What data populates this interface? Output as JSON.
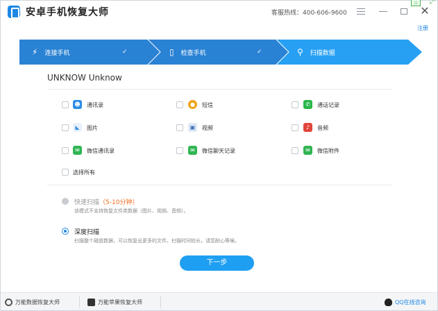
{
  "window": {
    "title": "安卓手机恢复大师",
    "hotline": "客服热线：400-606-9600",
    "register_link": "注册"
  },
  "steps": [
    {
      "label": "连接手机",
      "icon": "plug-icon",
      "done": true
    },
    {
      "label": "检查手机",
      "icon": "phone-icon",
      "done": true
    },
    {
      "label": "扫描数据",
      "icon": "search-icon",
      "done": false
    }
  ],
  "colors": {
    "step_done": "#2a82d4",
    "step_active": "#27a0f3",
    "accent": "#1e88e5",
    "highlight": "#f26b1d"
  },
  "device": {
    "name": "UNKNOW Unknow"
  },
  "categories": [
    {
      "label": "通讯录",
      "icon": "contacts-icon",
      "color": "#2d8ee8",
      "checked": false
    },
    {
      "label": "短信",
      "icon": "sms-icon",
      "color": "#f0a419",
      "checked": false
    },
    {
      "label": "通话记录",
      "icon": "call-log-icon",
      "color": "#28b84a",
      "checked": false
    },
    {
      "label": "图片",
      "icon": "picture-icon",
      "color": "#3a8de0",
      "checked": false
    },
    {
      "label": "视频",
      "icon": "video-icon",
      "color": "#3b6fb6",
      "checked": false
    },
    {
      "label": "音频",
      "icon": "audio-icon",
      "color": "#e2453c",
      "checked": false
    },
    {
      "label": "微信通讯录",
      "icon": "wechat-icon",
      "color": "#2fb551",
      "checked": false
    },
    {
      "label": "微信聊天记录",
      "icon": "wechat-icon",
      "color": "#2fb551",
      "checked": false
    },
    {
      "label": "微信附件",
      "icon": "wechat-icon",
      "color": "#2fb551",
      "checked": false
    }
  ],
  "select_all": {
    "label": "选择所有",
    "checked": false
  },
  "scan_modes": {
    "quick": {
      "title": "快速扫描",
      "time": "（5-10分钟）",
      "desc": "该模式不支持恢复文件类数据（图片、视频、音频）。",
      "selected": false
    },
    "deep": {
      "title": "深度扫描",
      "desc": "扫描整个磁盘数据，可以恢复出更多的文件，扫描时间较长，请您耐心等候。",
      "selected": true
    }
  },
  "next_button": "下一步",
  "bottom_bar": {
    "link1": "万能数据恢复大师",
    "link2": "万能苹果恢复大师",
    "qq": "QQ在线咨询"
  }
}
